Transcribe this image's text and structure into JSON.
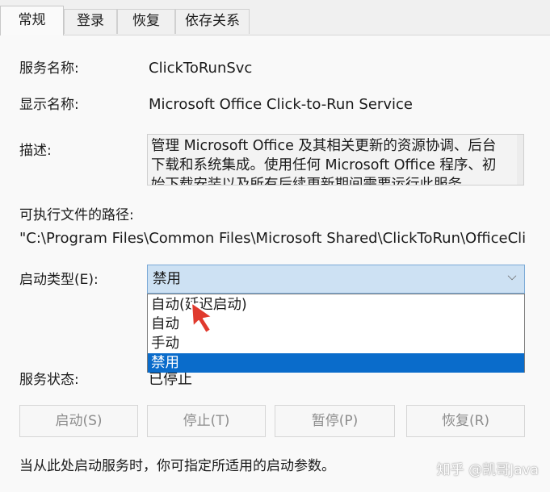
{
  "tabs": [
    {
      "label": "常规"
    },
    {
      "label": "登录"
    },
    {
      "label": "恢复"
    },
    {
      "label": "依存关系"
    }
  ],
  "fields": {
    "service_name_label": "服务名称:",
    "service_name_value": "ClickToRunSvc",
    "display_name_label": "显示名称:",
    "display_name_value": "Microsoft Office Click-to-Run Service",
    "description_label": "描述:",
    "description_lines": [
      "管理 Microsoft Office 及其相关更新的资源协调、后台",
      "下载和系统集成。使用任何 Microsoft Office 程序、初",
      "始下载安装以及所有后续更新期间需要运行此服务"
    ],
    "path_label": "可执行文件的路径:",
    "path_value": "\"C:\\Program Files\\Common Files\\Microsoft Shared\\ClickToRun\\OfficeClickTo",
    "startup_type_label": "启动类型(E):",
    "startup_type_value": "禁用",
    "status_label": "服务状态:",
    "status_value": "已停止",
    "note": "当从此处启动服务时，你可指定所适用的启动参数。"
  },
  "startup_options": [
    {
      "label": "自动(延迟启动)",
      "selected": false
    },
    {
      "label": "自动",
      "selected": false
    },
    {
      "label": "手动",
      "selected": false
    },
    {
      "label": "禁用",
      "selected": true
    }
  ],
  "buttons": {
    "start": "启动(S)",
    "stop": "停止(T)",
    "pause": "暂停(P)",
    "resume": "恢复(R)"
  },
  "watermark": "知乎 @凯哥Java",
  "colors": {
    "selection": "#0a6ccb",
    "combo_focus": "#cde1f3",
    "cursor": "#e03a2e"
  },
  "icons": {
    "dropdown": "chevron-down-icon",
    "pointer": "cursor-arrow-icon"
  }
}
